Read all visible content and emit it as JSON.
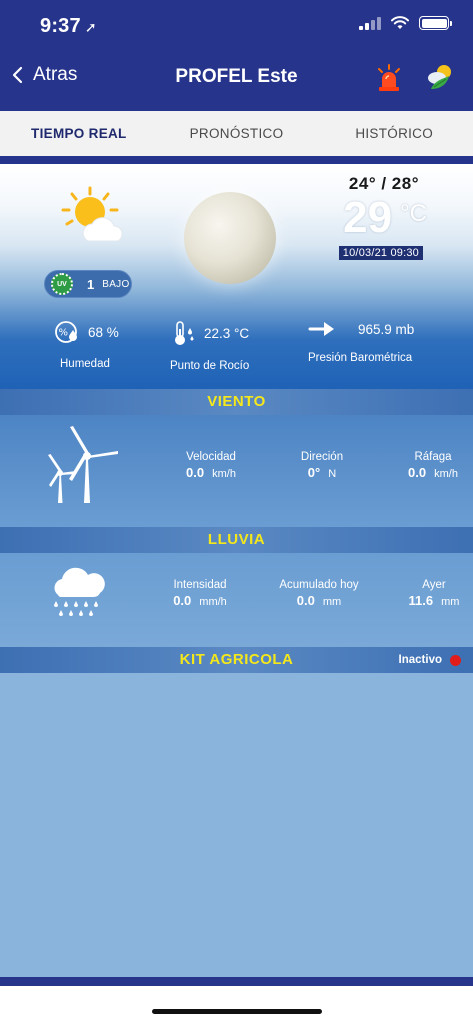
{
  "status_bar": {
    "time": "9:37",
    "location_glyph": "➚"
  },
  "nav": {
    "back_label": "Atras",
    "title": "PROFEL Este",
    "icons": [
      "alarm-siren-icon",
      "weather-app-icon"
    ]
  },
  "tabs": [
    {
      "label": "TIEMPO REAL",
      "active": true
    },
    {
      "label": "PRONÓSTICO",
      "active": false
    },
    {
      "label": "HISTÓRICO",
      "active": false
    }
  ],
  "current": {
    "min_max": "24°  /  28°",
    "temperature": "29",
    "temperature_unit": "°C",
    "timestamp": "10/03/21 09:30",
    "condition_icon": "partly-sunny-icon",
    "uv": {
      "value": "1",
      "level": "BAJO",
      "badge": "UV"
    }
  },
  "metrics": {
    "humidity": {
      "value": "68 %",
      "label": "Humedad"
    },
    "dew_point": {
      "value": "22.3 °C",
      "label": "Punto de Rocío"
    },
    "pressure": {
      "value": "965.9 mb",
      "label": "Presión Barométrica"
    }
  },
  "wind": {
    "title": "VIENTO",
    "speed": {
      "label": "Velocidad",
      "value": "0.0",
      "unit": "km/h"
    },
    "direction": {
      "label": "Direción",
      "value": "0°",
      "unit": "N"
    },
    "gust": {
      "label": "Ráfaga",
      "value": "0.0",
      "unit": "km/h"
    }
  },
  "rain": {
    "title": "LLUVIA",
    "intensity": {
      "label": "Intensidad",
      "value": "0.0",
      "unit": "mm/h"
    },
    "today": {
      "label": "Acumulado hoy",
      "value": "0.0",
      "unit": "mm"
    },
    "yesterday": {
      "label": "Ayer",
      "value": "11.6",
      "unit": "mm"
    }
  },
  "kit": {
    "title": "KIT AGRICOLA",
    "status": "Inactivo",
    "status_color": "#e21b1b"
  },
  "colors": {
    "brand": "#27348b",
    "section_title": "#f5e81a",
    "panel": "#5a8fcb"
  }
}
